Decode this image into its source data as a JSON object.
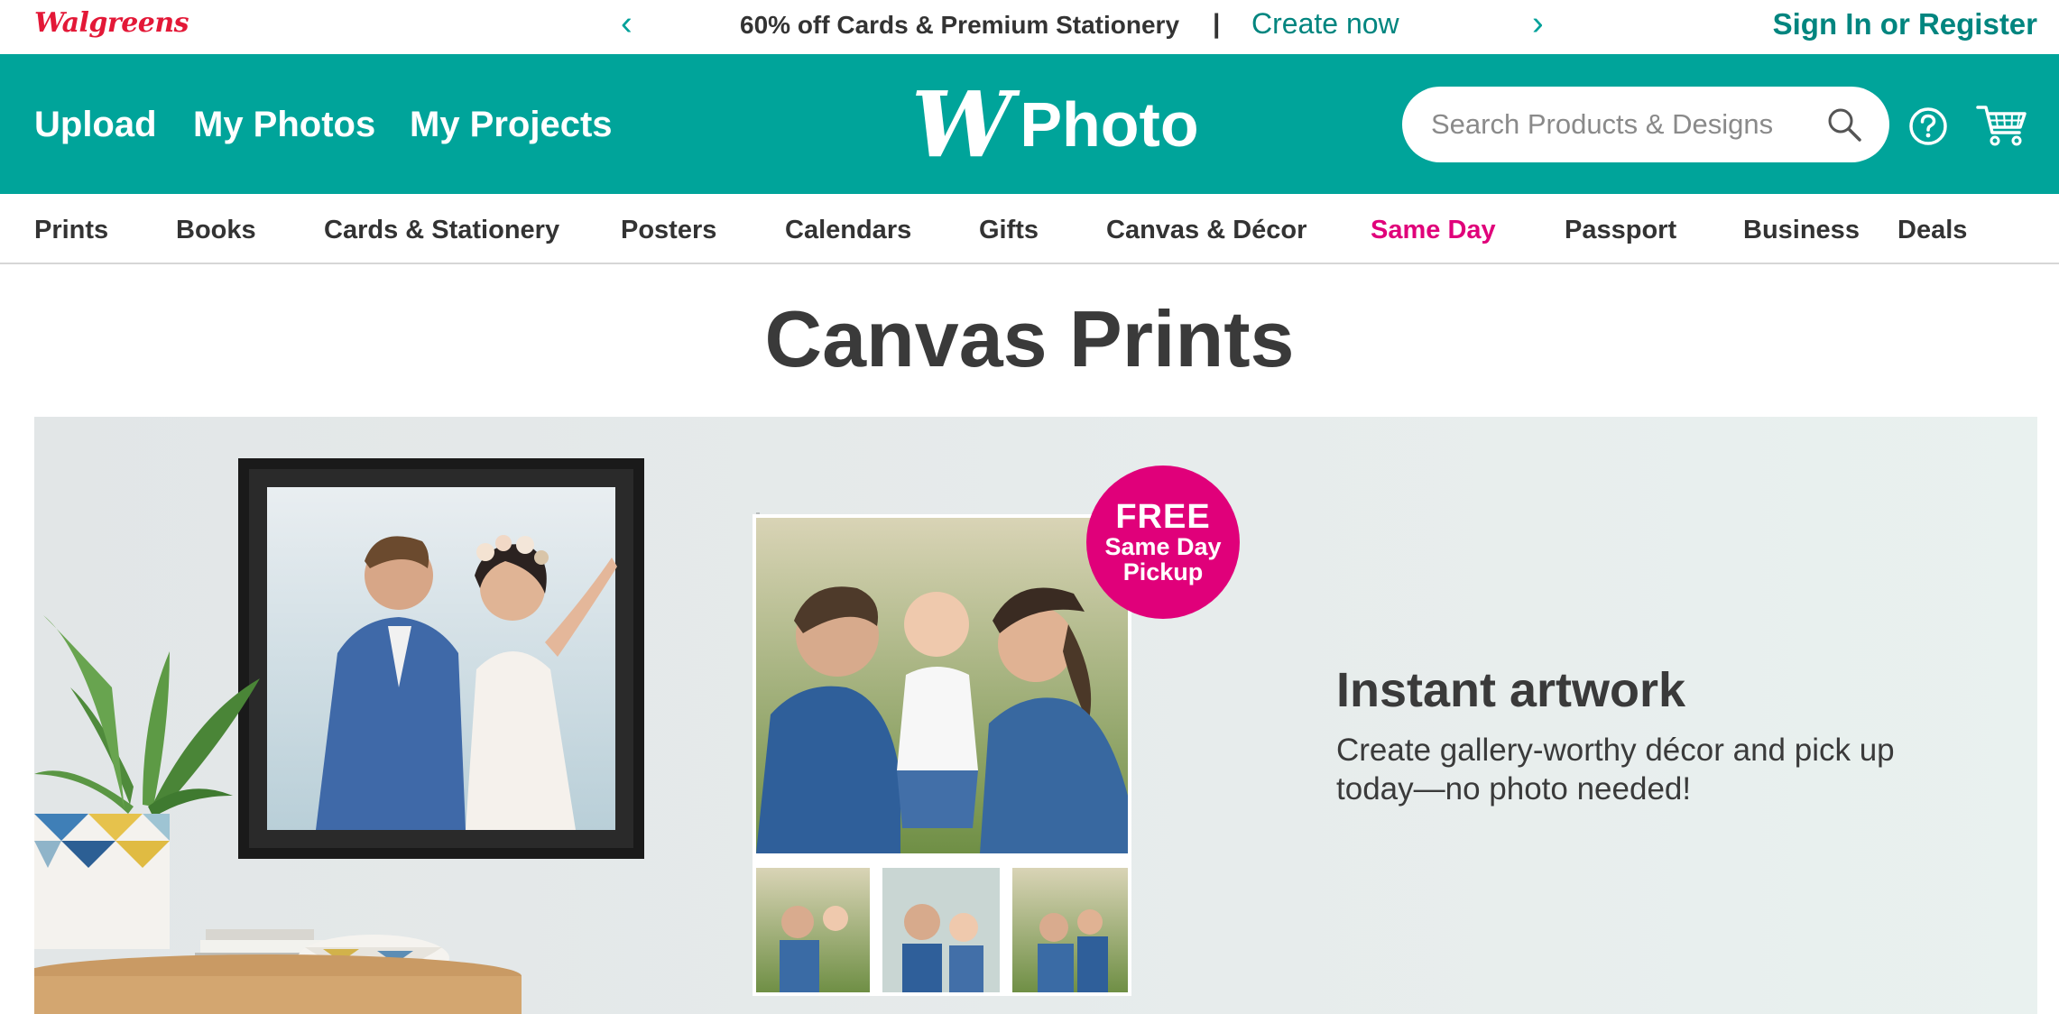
{
  "promo_bar": {
    "logo": "Walgreens",
    "prev_arrow": "‹",
    "next_arrow": "›",
    "message": "60% off Cards & Premium Stationery",
    "separator": "|",
    "cta": "Create now",
    "signin": "Sign In or Register"
  },
  "header": {
    "nav": [
      "Upload",
      "My Photos",
      "My Projects"
    ],
    "brand_mark": "W",
    "brand_text": "Photo",
    "search": {
      "placeholder": "Search Products & Designs",
      "value": ""
    },
    "icons": [
      "search-icon",
      "help-icon",
      "cart-icon"
    ],
    "colors": {
      "header_bg": "#00a49a",
      "accent_pink": "#e0007a",
      "logo_red": "#e31837",
      "link_teal": "#00857f"
    }
  },
  "categories": [
    {
      "label": "Prints",
      "highlight": false
    },
    {
      "label": "Books",
      "highlight": false
    },
    {
      "label": "Cards & Stationery",
      "highlight": false
    },
    {
      "label": "Posters",
      "highlight": false
    },
    {
      "label": "Calendars",
      "highlight": false
    },
    {
      "label": "Gifts",
      "highlight": false
    },
    {
      "label": "Canvas & Décor",
      "highlight": false
    },
    {
      "label": "Same Day",
      "highlight": true
    },
    {
      "label": "Passport",
      "highlight": false
    },
    {
      "label": "Business",
      "highlight": false
    },
    {
      "label": "Deals",
      "highlight": false
    }
  ],
  "page": {
    "title": "Canvas Prints"
  },
  "hero": {
    "badge": {
      "line1": "FREE",
      "line2": "Same Day",
      "line3": "Pickup"
    },
    "heading": "Instant artwork",
    "subtext": "Create gallery-worthy décor and pick up today—no photo needed!"
  }
}
